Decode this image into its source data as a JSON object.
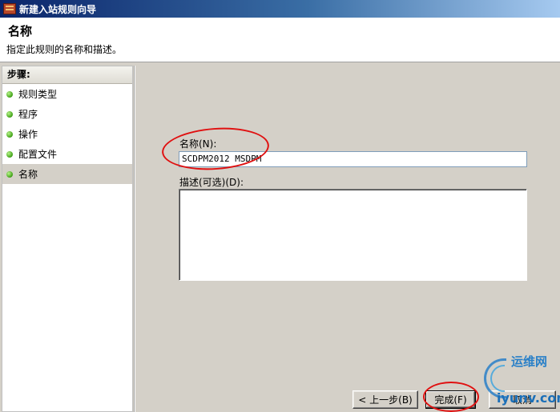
{
  "window": {
    "title": "新建入站规则向导"
  },
  "header": {
    "title": "名称",
    "description": "指定此规则的名称和描述。"
  },
  "steps": {
    "heading": "步骤:",
    "items": [
      {
        "label": "规则类型",
        "active": false
      },
      {
        "label": "程序",
        "active": false
      },
      {
        "label": "操作",
        "active": false
      },
      {
        "label": "配置文件",
        "active": false
      },
      {
        "label": "名称",
        "active": true
      }
    ]
  },
  "form": {
    "name_label": "名称(N):",
    "name_value": "SCDPM2012 MSDPM",
    "description_label": "描述(可选)(D):",
    "description_value": ""
  },
  "buttons": {
    "back": "< 上一步(B)",
    "finish": "完成(F)",
    "cancel": "取消"
  },
  "watermark": {
    "top": "运维网",
    "bottom": "iyunv.com"
  },
  "colors": {
    "annotation": "#e01010",
    "titlebar_start": "#0a246a",
    "step_dot": "#3fa016"
  }
}
